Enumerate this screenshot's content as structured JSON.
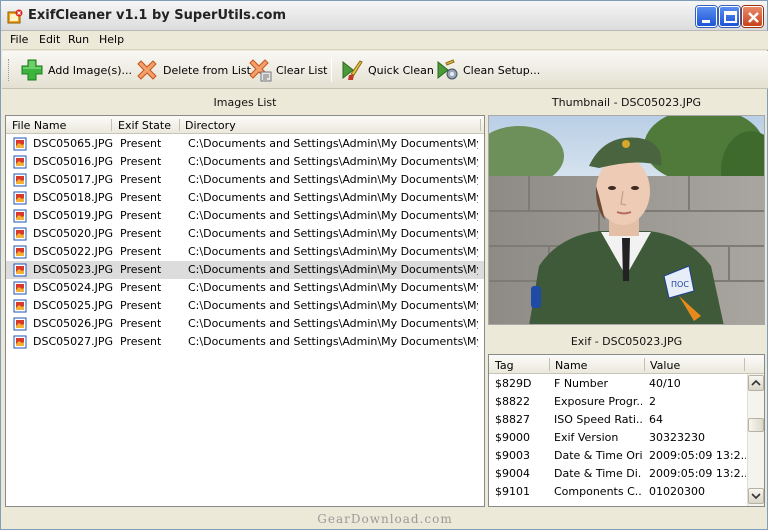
{
  "window": {
    "title": "ExifCleaner v1.1 by SuperUtils.com"
  },
  "menu": [
    "File",
    "Edit",
    "Run",
    "Help"
  ],
  "toolbar": {
    "add_images": "Add Image(s)...",
    "delete_from_list": "Delete from List",
    "clear_list": "Clear List",
    "quick_clean": "Quick Clean",
    "clean_setup": "Clean Setup..."
  },
  "images_list": {
    "title": "Images List",
    "columns": [
      "File Name",
      "Exif State",
      "Directory"
    ],
    "rows": [
      {
        "name": "DSC05065.JPG",
        "state": "Present",
        "dir": "C:\\Documents and Settings\\Admin\\My Documents\\My Pict..."
      },
      {
        "name": "DSC05016.JPG",
        "state": "Present",
        "dir": "C:\\Documents and Settings\\Admin\\My Documents\\My Pict..."
      },
      {
        "name": "DSC05017.JPG",
        "state": "Present",
        "dir": "C:\\Documents and Settings\\Admin\\My Documents\\My Pict..."
      },
      {
        "name": "DSC05018.JPG",
        "state": "Present",
        "dir": "C:\\Documents and Settings\\Admin\\My Documents\\My Pict..."
      },
      {
        "name": "DSC05019.JPG",
        "state": "Present",
        "dir": "C:\\Documents and Settings\\Admin\\My Documents\\My Pict..."
      },
      {
        "name": "DSC05020.JPG",
        "state": "Present",
        "dir": "C:\\Documents and Settings\\Admin\\My Documents\\My Pict..."
      },
      {
        "name": "DSC05022.JPG",
        "state": "Present",
        "dir": "C:\\Documents and Settings\\Admin\\My Documents\\My Pict..."
      },
      {
        "name": "DSC05023.JPG",
        "state": "Present",
        "dir": "C:\\Documents and Settings\\Admin\\My Documents\\My Pict...",
        "selected": true
      },
      {
        "name": "DSC05024.JPG",
        "state": "Present",
        "dir": "C:\\Documents and Settings\\Admin\\My Documents\\My Pict..."
      },
      {
        "name": "DSC05025.JPG",
        "state": "Present",
        "dir": "C:\\Documents and Settings\\Admin\\My Documents\\My Pict..."
      },
      {
        "name": "DSC05026.JPG",
        "state": "Present",
        "dir": "C:\\Documents and Settings\\Admin\\My Documents\\My Pict..."
      },
      {
        "name": "DSC05027.JPG",
        "state": "Present",
        "dir": "C:\\Documents and Settings\\Admin\\My Documents\\My Pict..."
      }
    ]
  },
  "thumbnail": {
    "title": "Thumbnail - DSC05023.JPG",
    "badge_text": "ПОС"
  },
  "exif": {
    "title": "Exif - DSC05023.JPG",
    "columns": [
      "Tag",
      "Name",
      "Value"
    ],
    "rows": [
      {
        "tag": "$829D",
        "name": "F Number",
        "value": "40/10"
      },
      {
        "tag": "$8822",
        "name": "Exposure Progr...",
        "value": "2"
      },
      {
        "tag": "$8827",
        "name": "ISO Speed Rati...",
        "value": "64"
      },
      {
        "tag": "$9000",
        "name": "Exif Version",
        "value": "30323230"
      },
      {
        "tag": "$9003",
        "name": "Date & Time Ori...",
        "value": "2009:05:09 13:2..."
      },
      {
        "tag": "$9004",
        "name": "Date & Time Di...",
        "value": "2009:05:09 13:2..."
      },
      {
        "tag": "$9101",
        "name": "Components C...",
        "value": "01020300"
      }
    ]
  },
  "watermark": "GearDownload.com",
  "colors": {
    "selected_row": "#dcdcdc",
    "title_close": "#c8431b",
    "title_button": "#1d54d6"
  }
}
